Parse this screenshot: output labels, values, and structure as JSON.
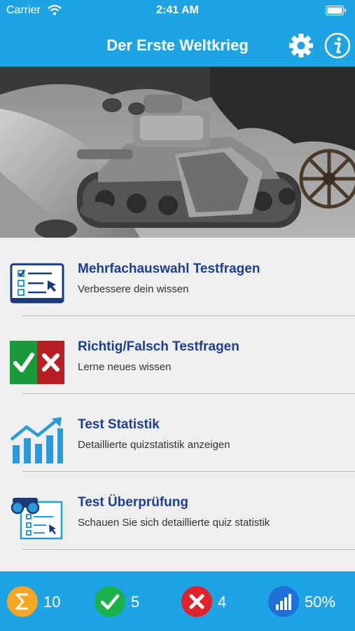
{
  "status_bar": {
    "carrier": "Carrier",
    "time": "2:41 AM"
  },
  "nav": {
    "title": "Der Erste Weltkrieg",
    "settings_icon": "gear-icon",
    "info_icon": "info-icon"
  },
  "hero": {
    "image": "ww1-tank-photo"
  },
  "menu": {
    "items": [
      {
        "title": "Mehrfachauswahl Testfragen",
        "subtitle": "Verbessere dein wissen",
        "icon": "checklist-icon"
      },
      {
        "title": "Richtig/Falsch Testfragen",
        "subtitle": "Lerne neues wissen",
        "icon": "true-false-icon"
      },
      {
        "title": "Test Statistik",
        "subtitle": "Detaillierte quizstatistik anzeigen",
        "icon": "chart-icon"
      },
      {
        "title": "Test Überprüfung",
        "subtitle": "Schauen Sie sich detaillierte quiz statistik",
        "icon": "review-icon"
      }
    ]
  },
  "stats": {
    "total": "10",
    "correct": "5",
    "wrong": "4",
    "percent": "50%"
  },
  "colors": {
    "primary": "#1ea3e4",
    "title_blue": "#1c3f93",
    "correct": "#1bb14b",
    "wrong": "#e0222a",
    "total": "#f5a623"
  }
}
